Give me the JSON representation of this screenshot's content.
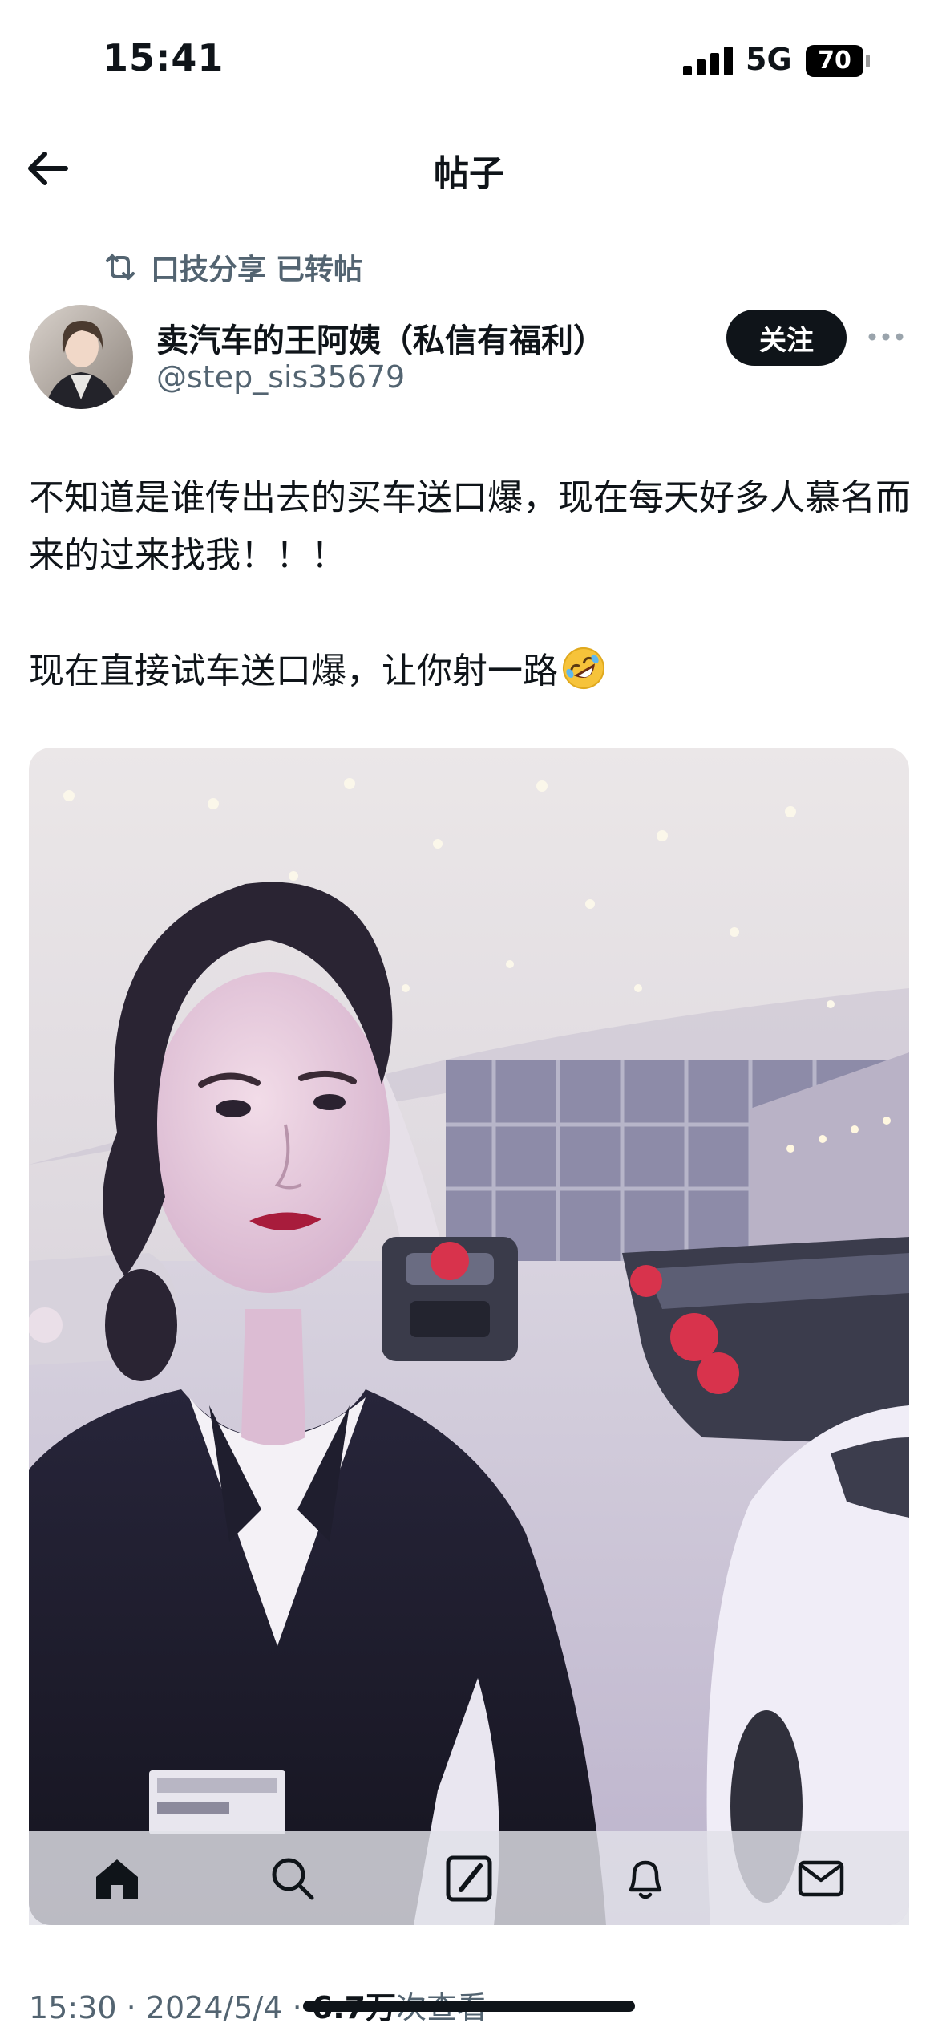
{
  "status_bar": {
    "time": "15:41",
    "network": "5G",
    "battery": "70"
  },
  "header": {
    "title": "帖子"
  },
  "repost": {
    "user": "口技分享",
    "label": "已转帖"
  },
  "author": {
    "name": "卖汽车的王阿姨（私信有福利）",
    "handle": "@step_sis35679",
    "follow_label": "关注"
  },
  "post": {
    "paragraph_1": "不知道是谁传出去的买车送口爆，现在每天好多人慕名而来的过来找我！！！",
    "paragraph_2": "现在直接试车送口爆，让你射一路",
    "emoji": "rolling-on-floor-laughing-emoji"
  },
  "nav": [
    "home-icon",
    "search-icon",
    "compose-icon",
    "bell-icon",
    "mail-icon"
  ],
  "meta": {
    "time": "15:30",
    "sep1": "·",
    "date": "2024/5/4",
    "sep2": "·",
    "views": "6.7万",
    "views_label": "次查看"
  },
  "colors": {
    "primary_text": "#0f1419",
    "secondary_text": "#536471",
    "button_bg": "#0f1419"
  }
}
